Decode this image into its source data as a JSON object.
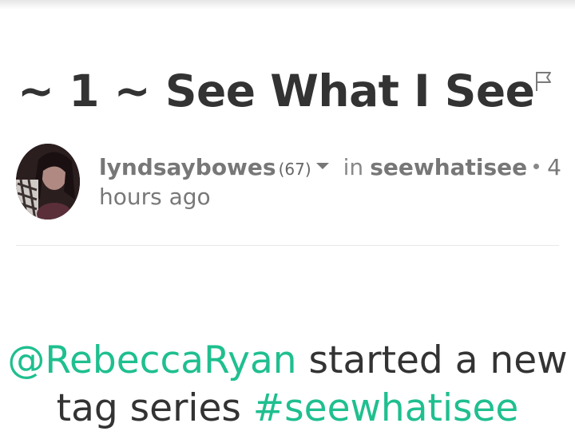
{
  "post": {
    "title": "~ 1 ~ See What I See",
    "author": "lyndsaybowes",
    "reputation": "(67)",
    "in_label": "in",
    "category": "seewhatisee",
    "time_line1": "4",
    "time_line2": "hours ago",
    "body": {
      "mention": "@RebeccaRyan",
      "text_after_mention": " started a new",
      "text_before_hashtag": "tag series ",
      "hashtag": "#seewhatisee"
    }
  },
  "icons": {
    "flag": "flag-icon",
    "caret": "caret-down-icon",
    "avatar": "user-avatar"
  },
  "colors": {
    "link_green": "#1fbf8f",
    "title": "#333333",
    "meta": "#787878"
  }
}
